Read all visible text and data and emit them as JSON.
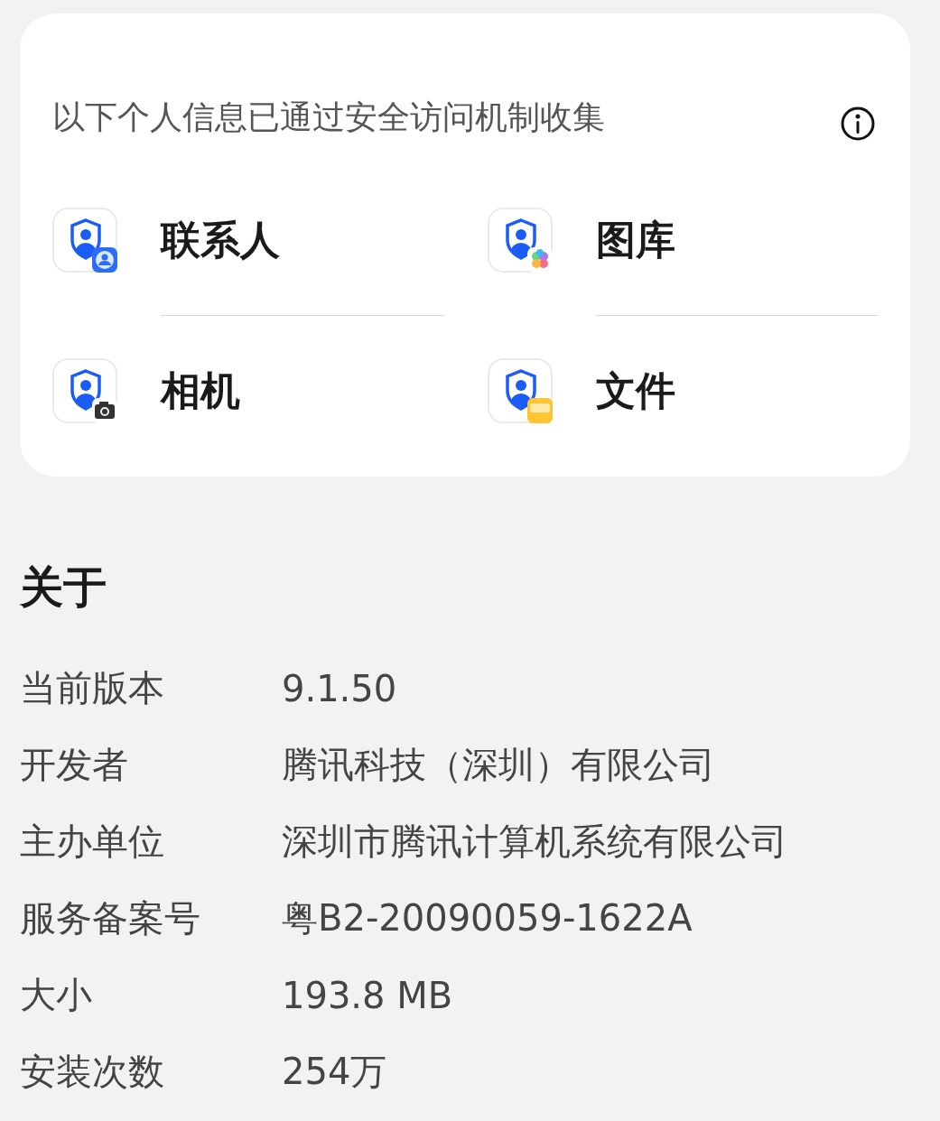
{
  "privacy_card": {
    "title": "以下个人信息已通过安全访问机制收集",
    "permissions": [
      {
        "kind": "contacts",
        "label": "联系人"
      },
      {
        "kind": "gallery",
        "label": "图库"
      },
      {
        "kind": "camera",
        "label": "相机"
      },
      {
        "kind": "files",
        "label": "文件"
      }
    ]
  },
  "about": {
    "heading": "关于",
    "rows": [
      {
        "label": "当前版本",
        "value": "9.1.50"
      },
      {
        "label": "开发者",
        "value": "腾讯科技（深圳）有限公司"
      },
      {
        "label": "主办单位",
        "value": "深圳市腾讯计算机系统有限公司"
      },
      {
        "label": "服务备案号",
        "value": "粤B2-20090059-1622A"
      },
      {
        "label": "大小",
        "value": "193.8 MB"
      },
      {
        "label": "安装次数",
        "value": "254万"
      }
    ]
  }
}
